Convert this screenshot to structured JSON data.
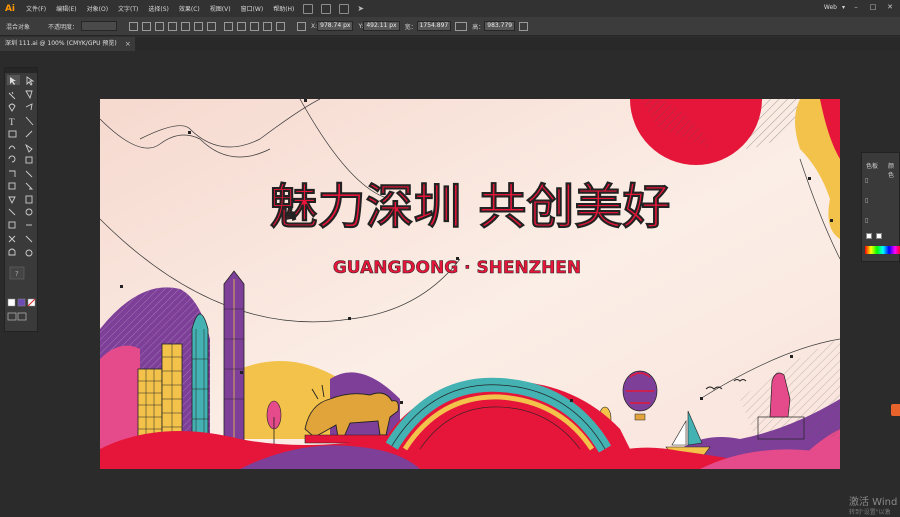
{
  "app": {
    "logo": "Ai",
    "workspace": "Web"
  },
  "menu": [
    "文件(F)",
    "编辑(E)",
    "对象(O)",
    "文字(T)",
    "选择(S)",
    "效果(C)",
    "视图(V)",
    "窗口(W)",
    "帮助(H)"
  ],
  "control_bar": {
    "mixed_objects": "混合对象",
    "opacity_label": "不透明度：",
    "x_label": "X:",
    "x_value": "978.74 px",
    "y_label": "Y:",
    "y_value": "492.11 px",
    "w_label": "宽：",
    "w_value": "1754.897",
    "h_label": "高：",
    "h_value": "983.779"
  },
  "document_tab": {
    "title": "深圳 111.ai @ 100% (CMYK/GPU 预览)",
    "close": "×"
  },
  "artwork": {
    "title": "魅力深圳 共创美好",
    "subtitle": "GUANGDONG · SHENZHEN"
  },
  "right_panel": {
    "tab1": "色板",
    "tab2": "颜色"
  },
  "watermark": {
    "line1": "激活 Wind",
    "line2": "转到\"设置\"以激"
  },
  "colors": {
    "red": "#e5163a",
    "purple": "#6a3b8f",
    "teal": "#44b1b3",
    "yellow": "#f3c24b",
    "pink": "#e54b8a"
  }
}
